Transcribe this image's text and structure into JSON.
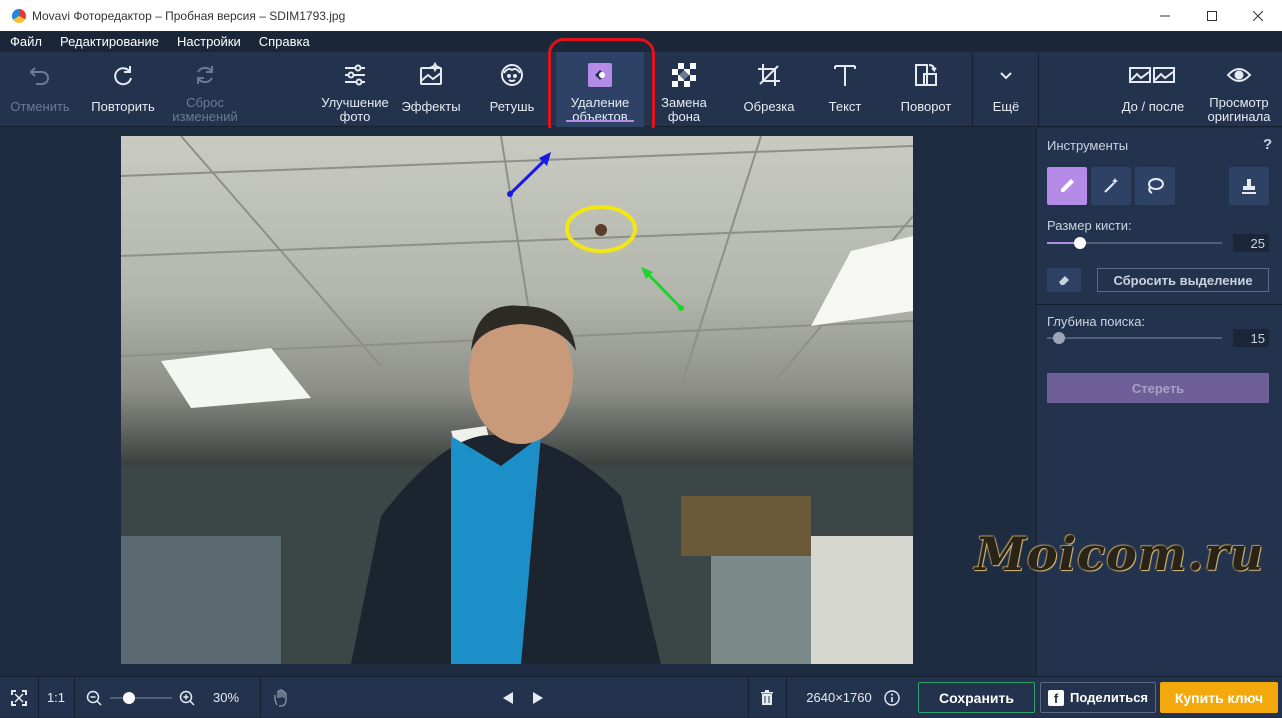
{
  "window": {
    "title": "Movavi Фоторедактор – Пробная версия – SDIM1793.jpg",
    "controls": [
      "minimize-icon",
      "maximize-icon",
      "close-icon"
    ]
  },
  "menu": [
    "Файл",
    "Редактирование",
    "Настройки",
    "Справка"
  ],
  "toolbar": {
    "undo": "Отменить",
    "redo": "Повторить",
    "reset_1": "Сброс",
    "reset_2": "изменений",
    "enhance_1": "Улучшение",
    "enhance_2": "фото",
    "effects": "Эффекты",
    "retouch": "Ретушь",
    "remove_1": "Удаление",
    "remove_2": "объектов",
    "bg_1": "Замена",
    "bg_2": "фона",
    "crop": "Обрезка",
    "text": "Текст",
    "rotate": "Поворот",
    "more": "Ещё",
    "before_after": "До / после",
    "preview_1": "Просмотр",
    "preview_2": "оригинала",
    "active_tool": "Удаление объектов"
  },
  "panel": {
    "title": "Инструменты",
    "help": "?",
    "brush_size_label": "Размер кисти:",
    "brush_size_value": "25",
    "brush_size_level": 0.19,
    "reset_selection": "Сбросить выделение",
    "search_depth_label": "Глубина поиска:",
    "search_depth_value": "15",
    "search_depth_level": 0.07,
    "erase": "Стереть"
  },
  "bottom": {
    "zoom_ratio": "1:1",
    "zoom_percent": "30%",
    "zoom_level": 0.3,
    "dimensions": "2640×1760",
    "save": "Сохранить",
    "share": "Поделиться",
    "buy": "Купить ключ"
  },
  "watermark": "Moicom.ru",
  "colors": {
    "accent": "#b48ce8",
    "highlight_box": "#e0121b",
    "buy_button": "#f3a90b",
    "save_border": "#2fa36b"
  }
}
